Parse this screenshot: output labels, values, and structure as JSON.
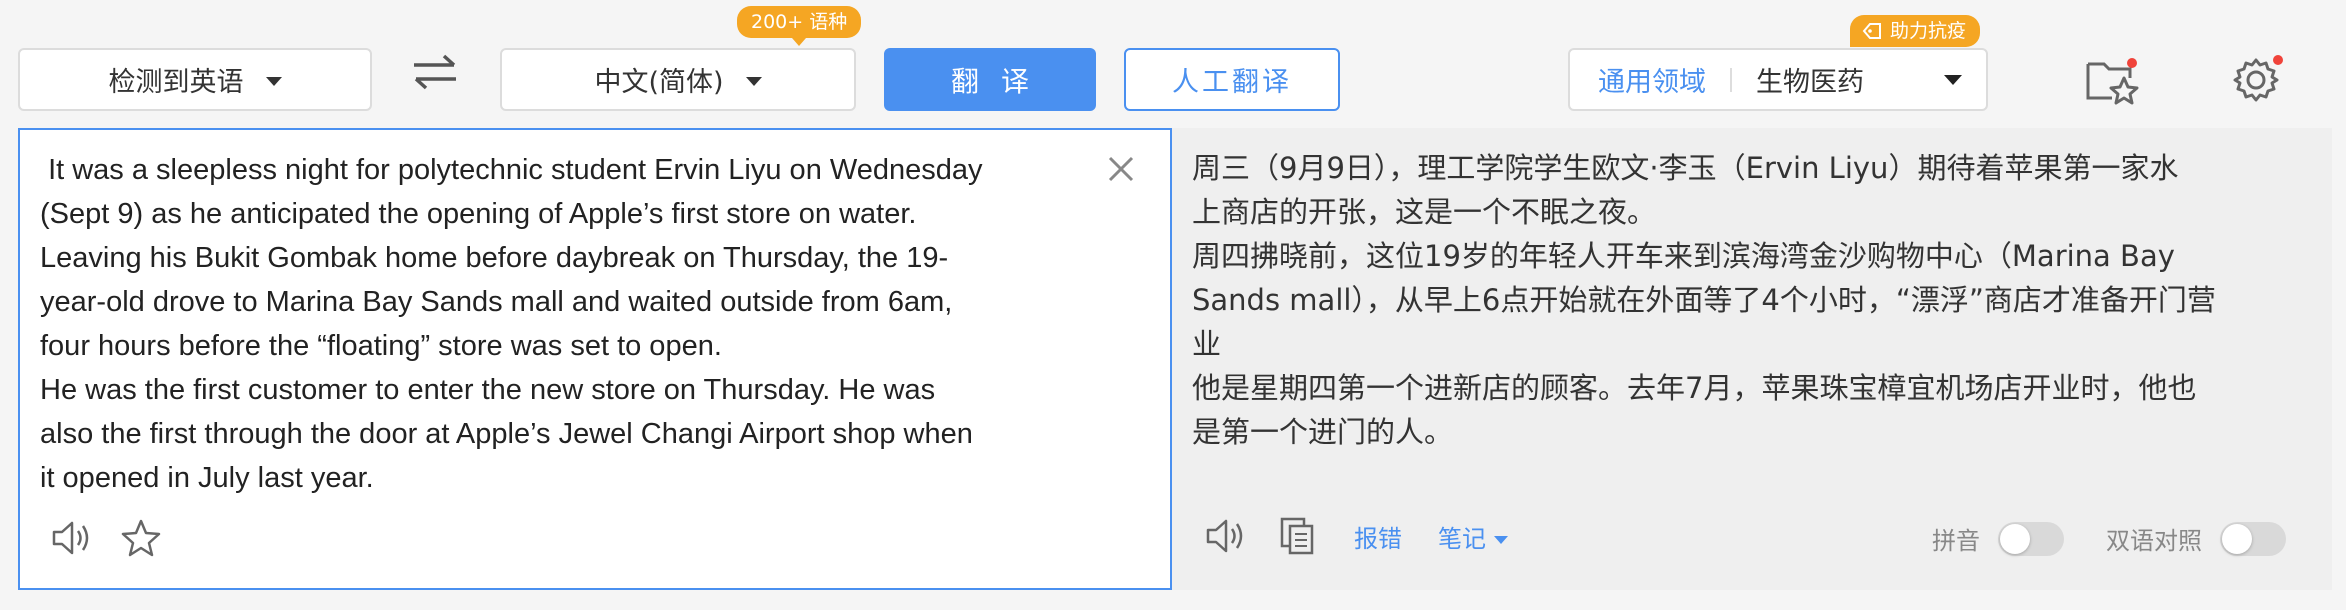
{
  "source_lang": {
    "label": "检测到英语"
  },
  "target_lang": {
    "label": "中文(简体)",
    "badge": "200+ 语种"
  },
  "buttons": {
    "translate": "翻译",
    "human_translate": "人工翻译"
  },
  "domain": {
    "active": "通用领域",
    "selected": "生物医药",
    "badge": "助力抗疫"
  },
  "source_text": " It was a sleepless night for polytechnic student Ervin Liyu on Wednesday\n(Sept 9) as he anticipated the opening of Apple’s first store on water.\nLeaving his Bukit Gombak home before daybreak on Thursday, the 19-\nyear-old drove to Marina Bay Sands mall and waited outside from 6am,\nfour hours before the “floating” store was set to open.\nHe was the first customer to enter the new store on Thursday. He was\nalso the first through the door at Apple’s Jewel Changi Airport shop when\nit opened in July last year.",
  "target_text": "周三（9月9日），理工学院学生欧文·李玉（Ervin Liyu）期待着苹果第一家水\n上商店的开张，这是一个不眠之夜。\n周四拂晓前，这位19岁的年轻人开车来到滨海湾金沙购物中心（Marina Bay\nSands mall），从早上6点开始就在外面等了4个小时，“漂浮”商店才准备开门营\n业\n他是星期四第一个进新店的顾客。去年7月，苹果珠宝樟宜机场店开业时，他也\n是第一个进门的人。",
  "tools": {
    "report_error": "报错",
    "notes": "笔记",
    "pinyin": "拼音",
    "bilingual": "双语对照"
  },
  "colors": {
    "accent": "#4a90f0",
    "badge": "#f5a623",
    "notify": "#f0433a"
  }
}
